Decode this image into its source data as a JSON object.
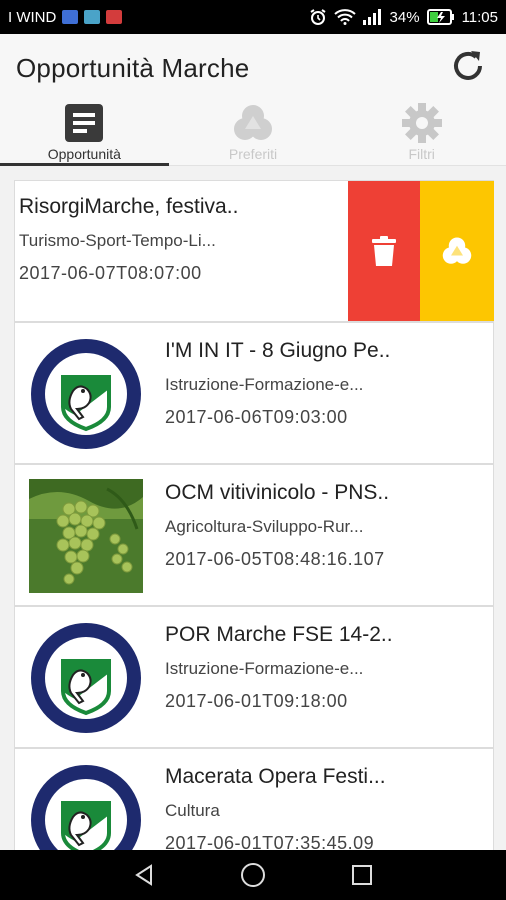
{
  "status_bar": {
    "carrier": "I WIND",
    "battery": "34%",
    "time": "11:05"
  },
  "app_bar": {
    "title": "Opportunità Marche",
    "refresh_icon": "refresh-icon"
  },
  "tabs": [
    {
      "label": "Opportunità",
      "icon": "document-icon",
      "active": true
    },
    {
      "label": "Preferiti",
      "icon": "favorites-icon",
      "active": false
    },
    {
      "label": "Filtri",
      "icon": "gear-icon",
      "active": false
    }
  ],
  "list": {
    "items": [
      {
        "title": "RisorgiMarche, festiva..",
        "category": "Turismo-Sport-Tempo-Li...",
        "date": "2017-06-07T08:07:00",
        "swiped": true,
        "actions": {
          "delete_icon": "trash-icon",
          "favorite_icon": "favorites-icon"
        }
      },
      {
        "title": "I'M IN IT - 8 Giugno Pe..",
        "category": "Istruzione-Formazione-e...",
        "date": "2017-06-06T09:03:00",
        "thumb": "regione-marche-logo"
      },
      {
        "title": "OCM vitivinicolo - PNS..",
        "category": "Agricoltura-Sviluppo-Rur...",
        "date": "2017-06-05T08:48:16.107",
        "thumb": "grapes-photo"
      },
      {
        "title": "POR Marche FSE 14-2..",
        "category": "Istruzione-Formazione-e...",
        "date": "2017-06-01T09:18:00",
        "thumb": "regione-marche-logo"
      },
      {
        "title": "Macerata Opera Festi...",
        "category": "Cultura",
        "date": "2017-06-01T07:35:45.09",
        "thumb": "regione-marche-logo"
      }
    ]
  },
  "colors": {
    "delete_action": "#ee4035",
    "favorite_action": "#fdc601",
    "logo_navy": "#1e2a6e",
    "logo_green": "#1a8a3a"
  },
  "nav_bar": {
    "back": "back-icon",
    "home": "home-icon",
    "recents": "recents-icon"
  }
}
